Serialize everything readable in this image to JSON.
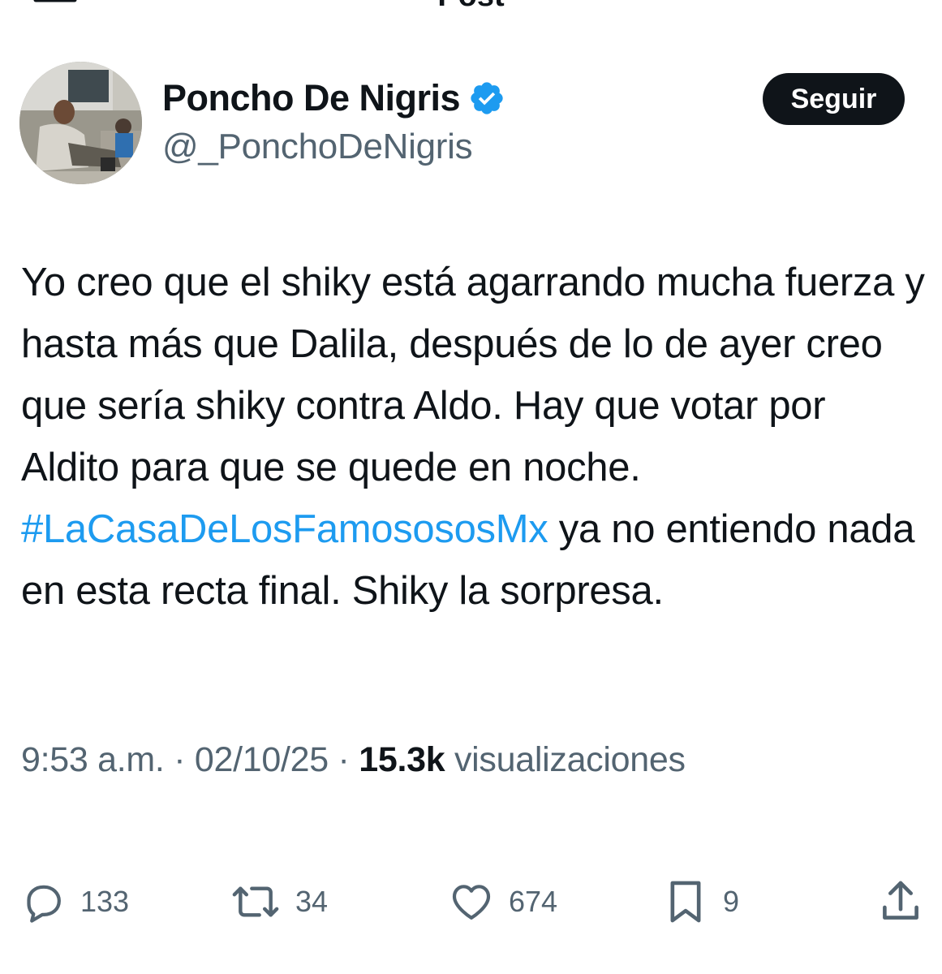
{
  "header": {
    "title": "Post"
  },
  "author": {
    "display_name": "Poncho De Nigris",
    "handle": "@_PonchoDeNigris",
    "verified": true,
    "follow_label": "Seguir"
  },
  "tweet": {
    "text_before_hashtag": "Yo creo que el shiky está agarrando mucha fuerza y hasta más que Dalila, después de lo de ayer creo que sería shiky contra Aldo. Hay que votar por Aldito para que se quede en noche. ",
    "hashtag": "#LaCasaDeLosFamosososMx",
    "text_after_hashtag": "  ya no entiendo nada en esta recta final. Shiky la sorpresa."
  },
  "meta": {
    "time": "9:53 a.m.",
    "separator": " · ",
    "date": "02/10/25",
    "views_count": "15.3k",
    "views_label": " visualizaciones"
  },
  "actions": {
    "replies": "133",
    "reposts": "34",
    "likes": "674",
    "bookmarks": "9"
  },
  "colors": {
    "text": "#0f1419",
    "secondary": "#536471",
    "link": "#1d9bf0",
    "verified": "#1d9bf0"
  }
}
